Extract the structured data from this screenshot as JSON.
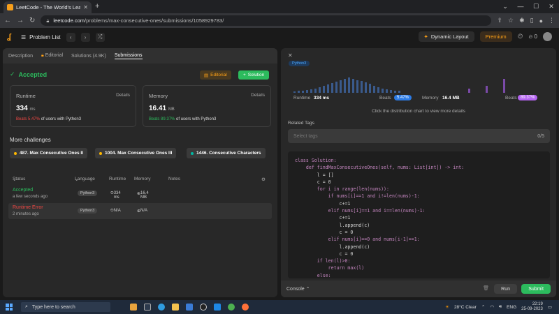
{
  "browser": {
    "tab_title": "LeetCode - The World's Leading",
    "url_host": "leetcode.com",
    "url_path": "/problems/max-consecutive-ones/submissions/1058929783/"
  },
  "topbar": {
    "problem_list": "Problem List",
    "dynamic_layout": "Dynamic Layout",
    "premium": "Premium",
    "streak": "0"
  },
  "left": {
    "tabs": [
      "Description",
      "Editorial",
      "Solutions (4.9K)",
      "Submissions"
    ],
    "status": "Accepted",
    "editorial_btn": "Editorial",
    "solution_btn": "Solution",
    "runtime": {
      "label": "Runtime",
      "details": "Details",
      "value": "334",
      "unit": "ms",
      "beats": "Beats 5.47%",
      "suffix": "of users with Python3"
    },
    "memory": {
      "label": "Memory",
      "details": "Details",
      "value": "16.41",
      "unit": "MB",
      "beats": "Beats 89.37%",
      "suffix": "of users with Python3"
    },
    "more_challenges": "More challenges",
    "challenges": [
      {
        "label": "487. Max Consecutive Ones II",
        "color": "#ffb800"
      },
      {
        "label": "1004. Max Consecutive Ones III",
        "color": "#ffb800"
      },
      {
        "label": "1446. Consecutive Characters",
        "color": "#00b8a3"
      }
    ],
    "table_headers": {
      "status": "Status",
      "language": "Language",
      "runtime": "Runtime",
      "memory": "Memory",
      "notes": "Notes"
    },
    "rows": [
      {
        "status": "Accepted",
        "time": "a few seconds ago",
        "lang": "Python3",
        "runtime": "334 ms",
        "memory": "16.4 MB"
      },
      {
        "status": "Runtime Error",
        "time": "2 minutes ago",
        "lang": "Python3",
        "runtime": "N/A",
        "memory": "N/A"
      }
    ]
  },
  "right": {
    "lang": "Python3",
    "runtime_label": "Runtime",
    "runtime_val": "334 ms",
    "beats_label": "Beats",
    "runtime_beats": "5.47%",
    "memory_label": "Memory",
    "memory_val": "16.4 MB",
    "memory_beats": "89.37%",
    "hint": "Click the distribution chart to view more details",
    "related_tags": "Related Tags",
    "tags_placeholder": "Select tags",
    "tags_count": "0/5",
    "code": [
      "class Solution:",
      "    def findMaxConsecutiveOnes(self, nums: List[int]) -> int:",
      "        l = []",
      "        c = 0",
      "        for i in range(len(nums)):",
      "            if nums[i]==1 and i!=len(nums)-1:",
      "                c+=1",
      "            elif nums[i]==1 and i==len(nums)-1:",
      "                c+=1",
      "                l.append(c)",
      "                c = 0",
      "            elif nums[i]==0 and nums[i-1]==1:",
      "                l.append(c)",
      "                c = 0",
      "        if len(l)>0:",
      "            return max(l)",
      "        else:"
    ],
    "console": "Console",
    "run": "Run",
    "submit": "Submit"
  },
  "taskbar": {
    "search": "Type here to search",
    "weather": "28°C  Clear",
    "lang": "ENG",
    "time": "22:19",
    "date": "25-09-2023"
  }
}
